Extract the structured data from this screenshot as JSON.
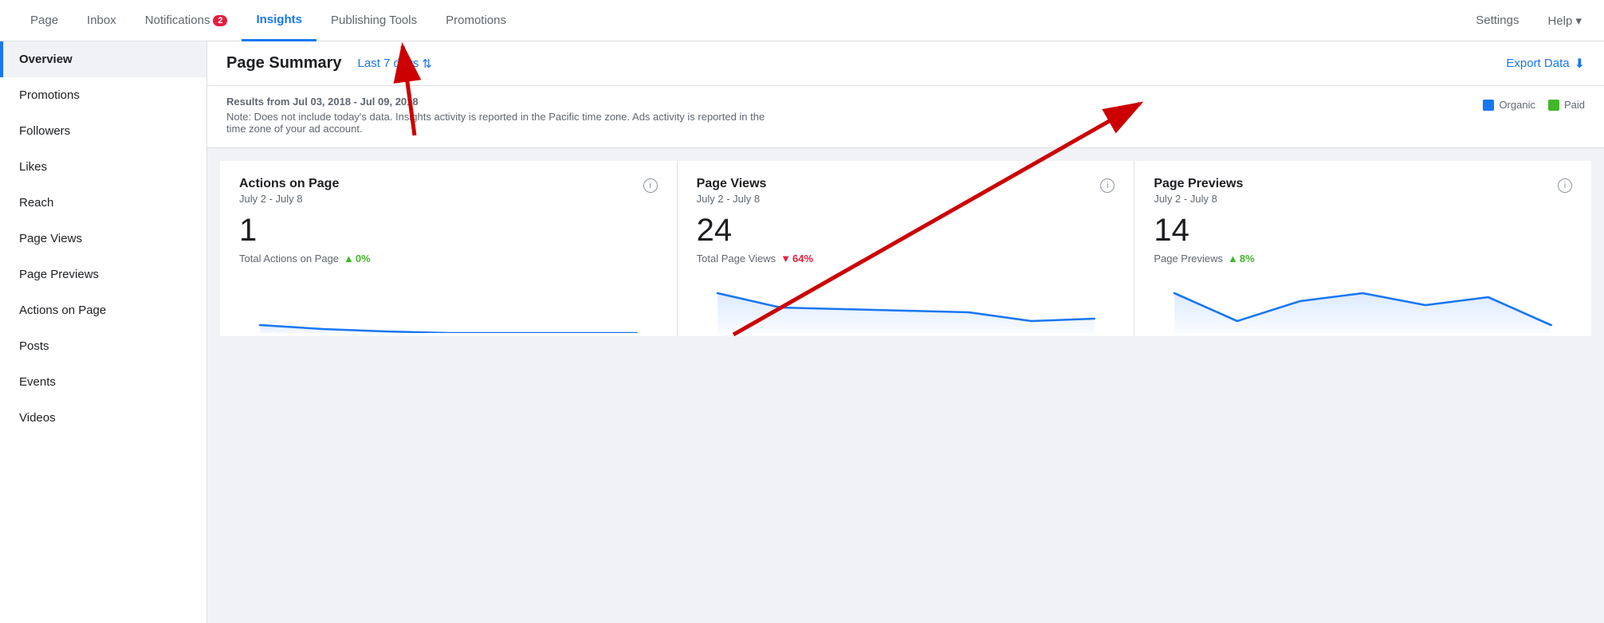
{
  "topNav": {
    "items": [
      {
        "label": "Page",
        "active": false,
        "badge": null
      },
      {
        "label": "Inbox",
        "active": false,
        "badge": null
      },
      {
        "label": "Notifications",
        "active": false,
        "badge": "2"
      },
      {
        "label": "Insights",
        "active": true,
        "badge": null
      },
      {
        "label": "Publishing Tools",
        "active": false,
        "badge": null
      },
      {
        "label": "Promotions",
        "active": false,
        "badge": null
      }
    ],
    "rightItems": [
      {
        "label": "Settings"
      },
      {
        "label": "Help ▾"
      }
    ]
  },
  "sidebar": {
    "items": [
      {
        "label": "Overview",
        "active": true
      },
      {
        "label": "Promotions",
        "active": false
      },
      {
        "label": "Followers",
        "active": false
      },
      {
        "label": "Likes",
        "active": false
      },
      {
        "label": "Reach",
        "active": false
      },
      {
        "label": "Page Views",
        "active": false
      },
      {
        "label": "Page Previews",
        "active": false
      },
      {
        "label": "Actions on Page",
        "active": false
      },
      {
        "label": "Posts",
        "active": false
      },
      {
        "label": "Events",
        "active": false
      },
      {
        "label": "Videos",
        "active": false
      }
    ]
  },
  "pageSummary": {
    "title": "Page Summary",
    "dateRange": "Last 7 days",
    "dateRangeIcon": "↕",
    "exportLabel": "Export Data",
    "exportIcon": "⬇"
  },
  "infoBar": {
    "resultsText": "Results from Jul 03, 2018 - Jul 09, 2018",
    "noteText": "Note: Does not include today's data. Insights activity is reported in the Pacific time zone. Ads activity is reported in the time zone of your ad account.",
    "legend": {
      "organic": "Organic",
      "paid": "Paid"
    }
  },
  "cards": [
    {
      "title": "Actions on Page",
      "subtitle": "July 2 - July 8",
      "number": "1",
      "metricLabel": "Total Actions on Page",
      "trendDirection": "up",
      "trendValue": "0%",
      "chartPoints": "20,60 80,65 140,68 200,70 260,70 320,70 380,70"
    },
    {
      "title": "Page Views",
      "subtitle": "July 2 - July 8",
      "number": "24",
      "metricLabel": "Total Page Views",
      "trendDirection": "down",
      "trendValue": "64%",
      "chartPoints": "20,20 80,38 140,40 200,42 260,44 320,55 380,52"
    },
    {
      "title": "Page Previews",
      "subtitle": "July 2 - July 8",
      "number": "14",
      "metricLabel": "Page Previews",
      "trendDirection": "up",
      "trendValue": "8%",
      "chartPoints": "20,20 80,55 140,30 200,20 260,35 320,25 380,60"
    }
  ]
}
